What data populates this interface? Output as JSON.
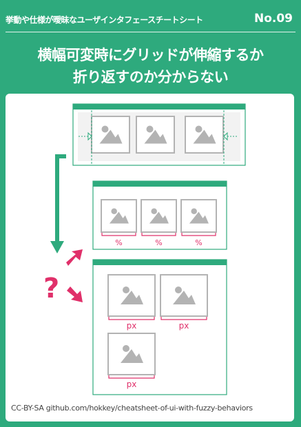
{
  "header": {
    "category": "挙動や仕様が曖昧なユーザインタフェースチートシート",
    "number": "No.09"
  },
  "title": {
    "line1": "横幅可変時にグリッドが伸縮するか",
    "line2": "折り返すのか分からない"
  },
  "diagram": {
    "percent_label": "%",
    "px_label": "px",
    "question_mark": "?"
  },
  "colors": {
    "brand_green": "#2eaa7d",
    "accent_pink": "#e0306a",
    "image_gray": "#b3b3b3"
  },
  "icons": [
    "image-placeholder-icon",
    "resize-arrow-icon",
    "down-arrow-icon",
    "diagonal-arrow-icon"
  ],
  "footer": {
    "credit": "CC-BY-SA github.com/hokkey/cheatsheet-of-ui-with-fuzzy-behaviors"
  }
}
